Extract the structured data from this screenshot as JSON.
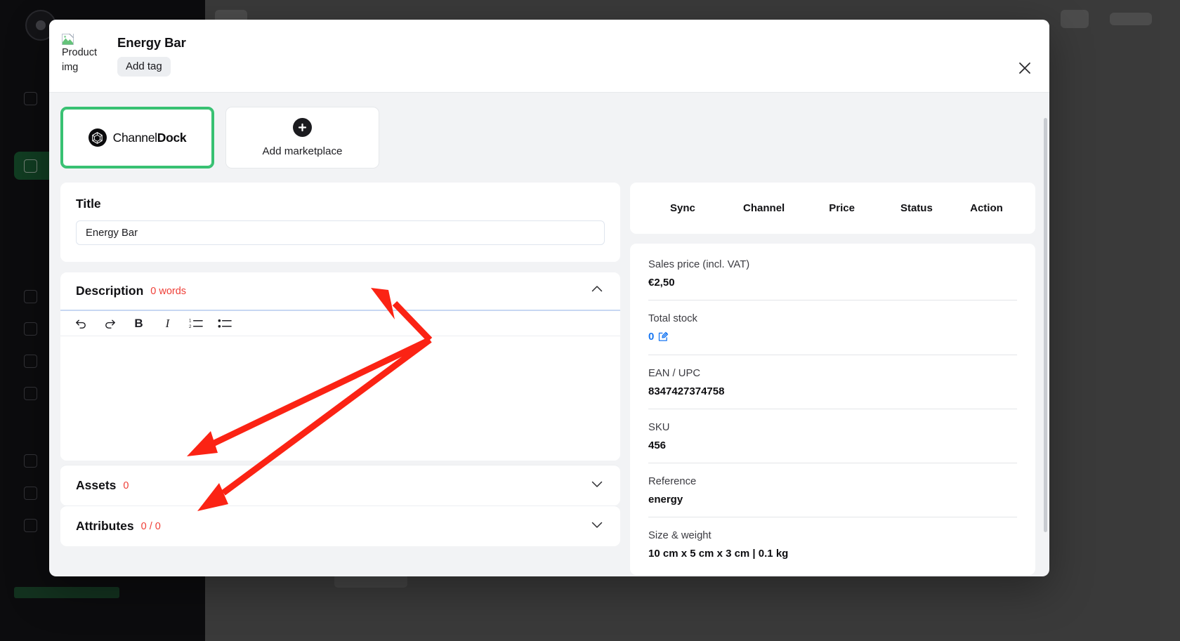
{
  "modal": {
    "header": {
      "thumb_alt": "Product img",
      "product_title": "Energy Bar",
      "add_tag_label": "Add tag",
      "close_icon": "close-icon"
    },
    "marketplaces": [
      {
        "name": "ChannelDock",
        "name_light": "Channel",
        "name_bold": "Dock",
        "selected": true
      },
      {
        "label": "Add marketplace",
        "icon": "plus-icon",
        "selected": false
      }
    ],
    "left": {
      "title_section": {
        "label": "Title",
        "value": "Energy Bar",
        "placeholder": "Title"
      },
      "description_section": {
        "title": "Description",
        "count": "0 words",
        "expanded": true,
        "chevron": "chevron-up-icon",
        "toolbar": [
          {
            "name": "undo-icon",
            "label": "undo"
          },
          {
            "name": "redo-icon",
            "label": "redo"
          },
          {
            "name": "bold-icon",
            "label": "B"
          },
          {
            "name": "italic-icon",
            "label": "I"
          },
          {
            "name": "ordered-list-icon",
            "label": "ordered list"
          },
          {
            "name": "bullet-list-icon",
            "label": "bullet list"
          }
        ],
        "content": ""
      },
      "assets_section": {
        "title": "Assets",
        "count": "0",
        "expanded": false,
        "chevron": "chevron-down-icon"
      },
      "attributes_section": {
        "title": "Attributes",
        "count": "0 / 0",
        "expanded": false,
        "chevron": "chevron-down-icon"
      }
    },
    "right": {
      "sync_table": {
        "columns": [
          "Sync",
          "Channel",
          "Price",
          "Status",
          "Action"
        ],
        "rows": []
      },
      "details": [
        {
          "label": "Sales price (incl. VAT)",
          "value": "€2,50",
          "link": false
        },
        {
          "label": "Total stock",
          "value": "0",
          "link": true,
          "edit_icon": "edit-icon"
        },
        {
          "label": "EAN / UPC",
          "value": "8347427374758",
          "link": false
        },
        {
          "label": "SKU",
          "value": "456",
          "link": false
        },
        {
          "label": "Reference",
          "value": "energy",
          "link": false
        },
        {
          "label": "Size & weight",
          "value": "10 cm x 5 cm x 3 cm | 0.1 kg",
          "link": false
        }
      ]
    }
  },
  "colors": {
    "accent_green": "#38c172",
    "danger_red": "#ef3e36",
    "link_blue": "#1877f2",
    "annotation_red": "#fb2314",
    "modal_bg": "#f2f3f5"
  },
  "annotations": {
    "arrow_count": 2,
    "color": "#fb2314"
  }
}
